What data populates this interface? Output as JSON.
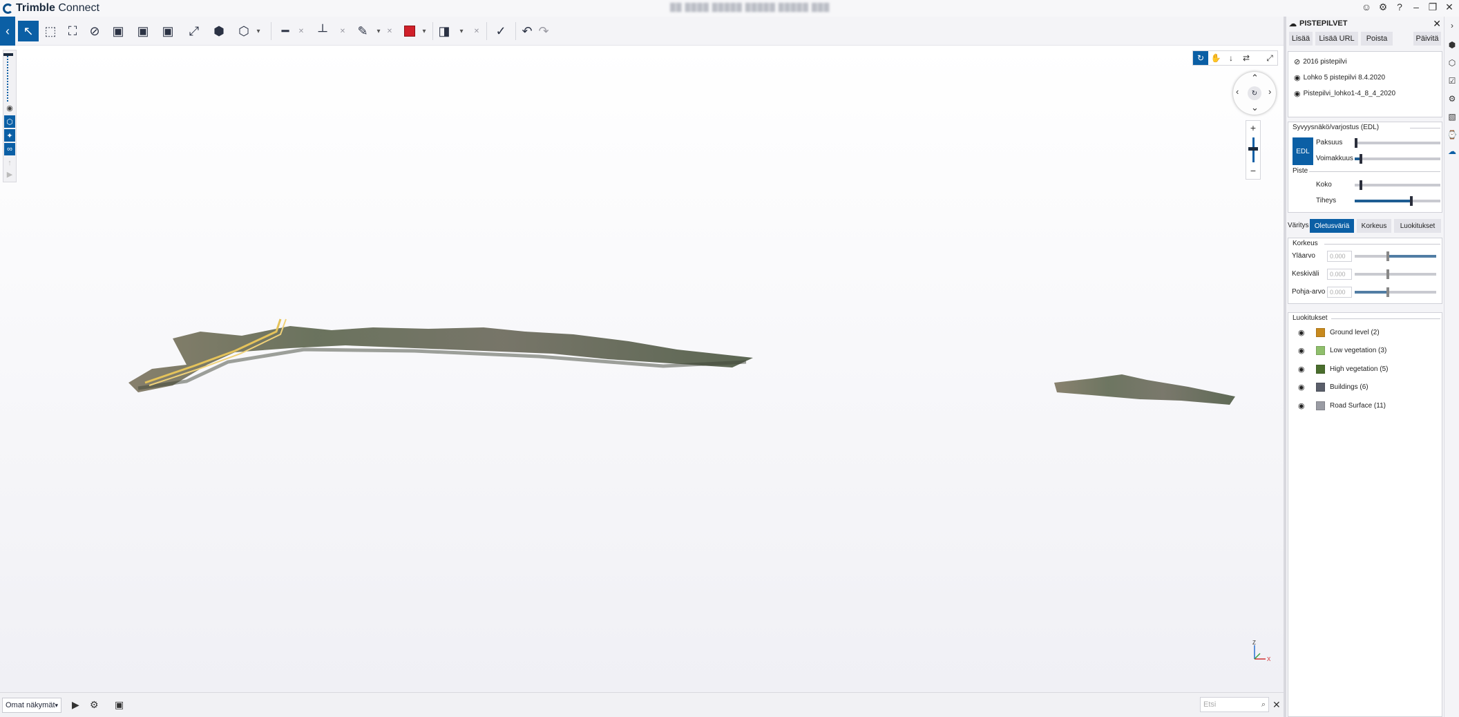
{
  "app": {
    "name_prefix": "Trimble",
    "name_suffix": " Connect",
    "doc_title": "██ ████ █████ █████ █████ ███"
  },
  "window_icons": {
    "user": "☺",
    "settings": "⚙",
    "help": "?",
    "minimize": "–",
    "restore": "❐",
    "close": "✕"
  },
  "toolbar": {
    "back": "‹",
    "select": "↖",
    "box_select": "⬚",
    "fit": "⛶",
    "hide": "⊘",
    "view1": "▣",
    "view2": "▣",
    "view3": "▣",
    "expand": "⤢",
    "objects": "⬢",
    "cube": "⬡",
    "dropdown": "▾",
    "measure": "━",
    "measure_clear": "✕",
    "measure2": "┴",
    "measure2_clear": "✕",
    "pen": "✎",
    "pen_clear": "✕",
    "section": "◨",
    "section_clear": "✕",
    "checklist": "✓",
    "undo": "↶",
    "redo": "↷",
    "color": "#d0202a"
  },
  "leftbar": {
    "eye": "◉",
    "model": "⬡",
    "cog": "✦",
    "link": "∞",
    "walk": "↑",
    "play": "▶"
  },
  "navtools": {
    "orbit": "↻",
    "pan": "✋",
    "walk": "↓",
    "swap": "⇄",
    "expand": "⤢"
  },
  "navcube": {
    "up": "⌃",
    "down": "⌄",
    "left": "‹",
    "right": "›",
    "center": "↻"
  },
  "zoom": {
    "plus": "+",
    "minus": "−"
  },
  "axis": {
    "z": "Z",
    "x": "X"
  },
  "bottombar": {
    "views_select": "Omat näkymät",
    "views_dropdown": "▾",
    "play": "▶",
    "settings": "⚙",
    "camera": "▣",
    "search_placeholder": "Etsi",
    "search_icon": "⌕",
    "close": "✕"
  },
  "panel": {
    "title": "PISTEPILVET",
    "title_icon": "☁",
    "close": "✕",
    "buttons": [
      "Lisää",
      "Lisää URL",
      "Poista",
      "Päivitä"
    ],
    "layers": [
      {
        "name": "2016 pistepilvi",
        "visible": false
      },
      {
        "name": "Lohko 5 pistepilvi 8.4.2020",
        "visible": true
      },
      {
        "name": "Pistepilvi_lohko1-4_8_4_2020",
        "visible": true
      }
    ],
    "edl": {
      "title": "Syvyysnäkö/varjostus (EDL)",
      "button": "EDL",
      "thickness_label": "Paksuus",
      "strength_label": "Voimakkuus",
      "thickness_value": 0.02,
      "strength_value": 0.06
    },
    "point": {
      "title": "Piste",
      "size_label": "Koko",
      "density_label": "Tiheys",
      "size_value": 0.08,
      "density_value": 0.65
    },
    "coloring": {
      "label": "Väritys",
      "tabs": [
        "Oletusväriä",
        "Korkeus",
        "Luokitukset"
      ],
      "active_tab": 0
    },
    "height": {
      "title": "Korkeus",
      "rows": [
        {
          "label": "Yläarvo",
          "value": "0.000"
        },
        {
          "label": "Keskiväli",
          "value": "0.000"
        },
        {
          "label": "Pohja-arvo",
          "value": "0.000"
        }
      ]
    },
    "classifications": {
      "title": "Luokitukset",
      "items": [
        {
          "name": "Ground level (2)",
          "color": "#c88a1e"
        },
        {
          "name": "Low vegetation (3)",
          "color": "#8fbf6c"
        },
        {
          "name": "High vegetation (5)",
          "color": "#4a6e2d"
        },
        {
          "name": "Buildings (6)",
          "color": "#5a5e6a"
        },
        {
          "name": "Road Surface (11)",
          "color": "#9a9ca4"
        }
      ]
    }
  },
  "rightbar": {
    "i1": "›",
    "i2": "⬢",
    "i3": "⬡",
    "i4": "☑",
    "i5": "⚙",
    "i6": "▧",
    "i7": "⌚",
    "i8": "☁"
  }
}
